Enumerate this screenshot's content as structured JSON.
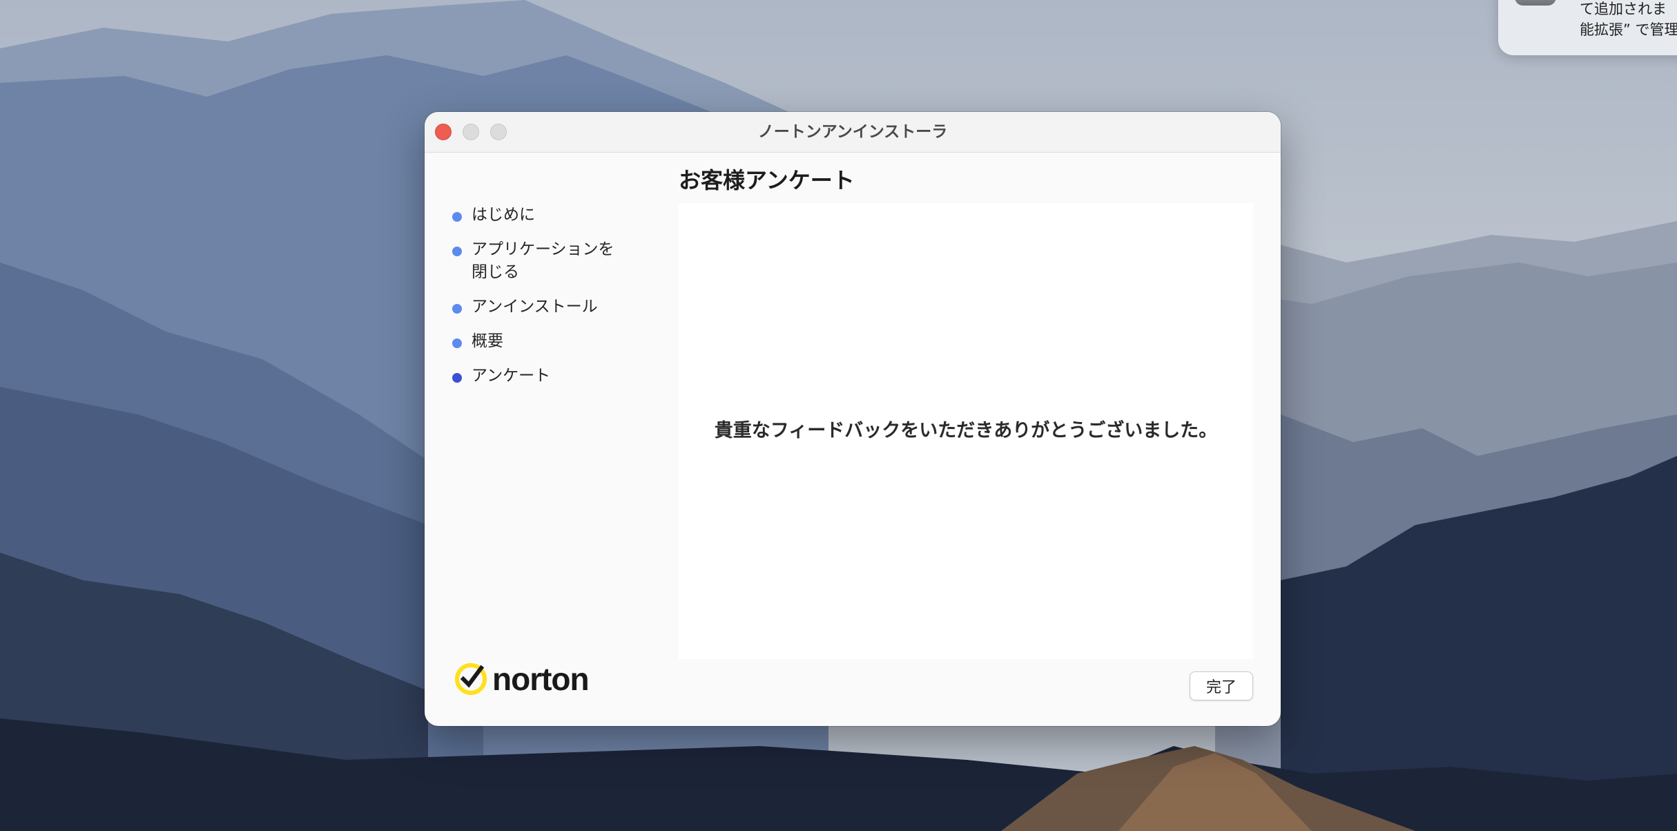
{
  "notification": {
    "lines": [
      "て追加されま",
      "能拡張” で管理"
    ]
  },
  "window": {
    "title": "ノートンアンインストーラ"
  },
  "sidebar": {
    "steps": [
      {
        "label": "はじめに",
        "state": "completed"
      },
      {
        "label": "アプリケーションを閉じる",
        "state": "completed"
      },
      {
        "label": "アンインストール",
        "state": "completed"
      },
      {
        "label": "概要",
        "state": "completed"
      },
      {
        "label": "アンケート",
        "state": "current"
      }
    ]
  },
  "main": {
    "heading": "お客様アンケート",
    "message": "貴重なフィードバックをいただきありがとうございました。"
  },
  "logo": {
    "text": "norton",
    "mark_color": "#ffe01b"
  },
  "buttons": {
    "done_label": "完了"
  },
  "colors": {
    "step_dot": "#5b8bef",
    "step_dot_current": "#3d4fd6",
    "close_button": "#ee5d52"
  }
}
